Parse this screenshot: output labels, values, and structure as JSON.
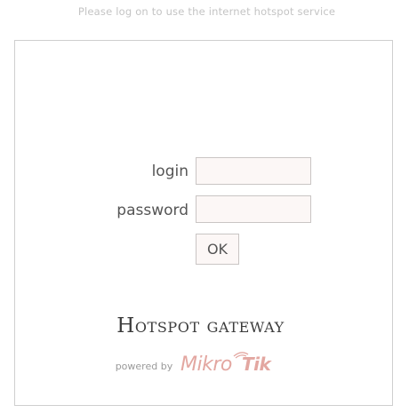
{
  "header": {
    "notice": "Please log on to use the internet hotspot service"
  },
  "form": {
    "login_label": "login",
    "login_value": "",
    "password_label": "password",
    "password_value": "",
    "ok_label": "OK"
  },
  "footer": {
    "brand": "Hotspot gateway",
    "powered_by": "powered by",
    "logo_name": "mikrotik-logo",
    "logo_text": "MikroTik"
  },
  "colors": {
    "notice_text": "#c4c4c4",
    "panel_border": "#cfcfcf",
    "field_background": "#fcf7f6",
    "logo_accent": "#e3a7a1"
  }
}
